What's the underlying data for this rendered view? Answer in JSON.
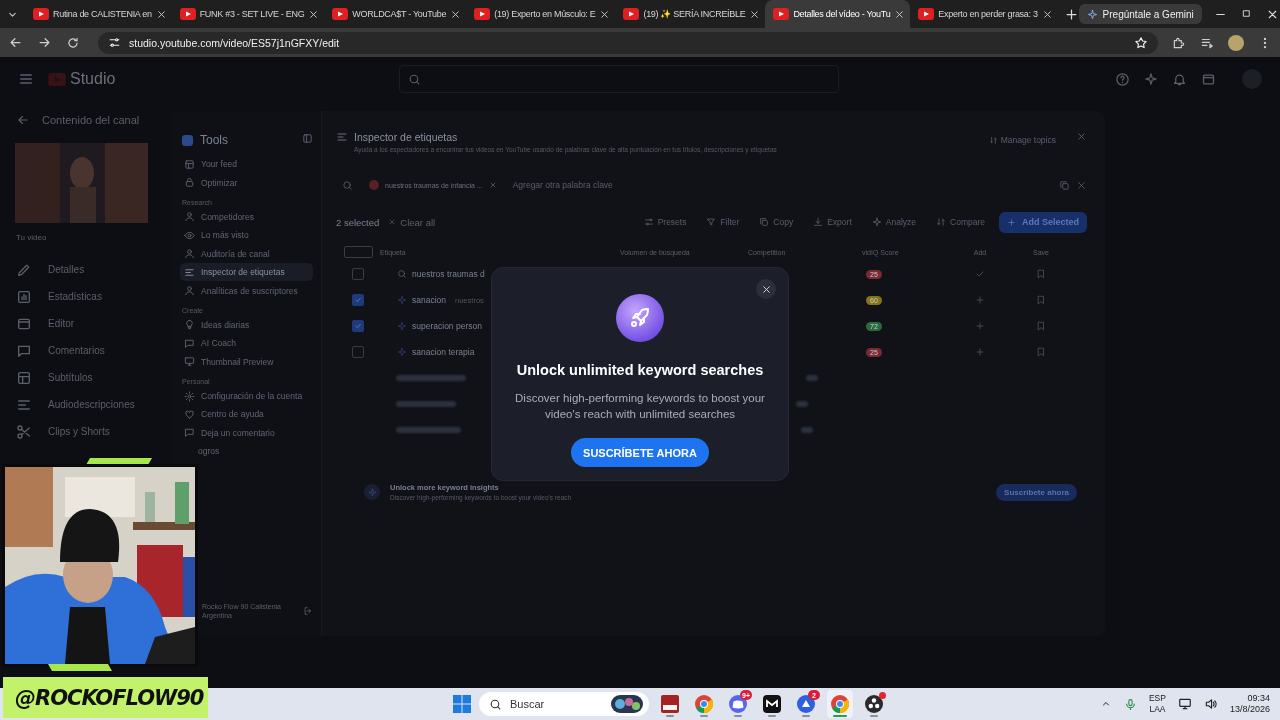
{
  "browser": {
    "tabs": [
      {
        "title": "Rutina de CALISTENIA en",
        "selected": false
      },
      {
        "title": "FUNK #3 - SET LIVE - ENG",
        "selected": false
      },
      {
        "title": "WORLDCA$T - YouTube",
        "selected": false
      },
      {
        "title": "(19) Experto en Músculo: E",
        "selected": false
      },
      {
        "title": "(19) ✨ SERÍA INCREÍBLE",
        "selected": false
      },
      {
        "title": "Detalles del vídeo - YouTu",
        "selected": true
      },
      {
        "title": "Experto en perder grasa: 3",
        "selected": false
      }
    ],
    "gemini_button": "Pregúntale a Gemini",
    "url": "studio.youtube.com/video/ES57j1nGFXY/edit"
  },
  "studio": {
    "logo": "Studio",
    "back_title": "Contenido del canal",
    "video_label": "Tu video",
    "nav": [
      "Detalles",
      "Estadísticas",
      "Editor",
      "Comentarios",
      "Subtítulos",
      "Audiodescripciones",
      "Clips y Shorts"
    ]
  },
  "tools": {
    "title": "Tools",
    "sections": [
      {
        "items": [
          {
            "label": "Your feed",
            "selected": false
          },
          {
            "label": "Optimizar",
            "selected": false
          }
        ]
      },
      {
        "heading": "Research",
        "items": [
          {
            "label": "Competidores",
            "selected": false
          },
          {
            "label": "Lo más visto",
            "selected": false
          },
          {
            "label": "Auditoría de canal",
            "selected": false
          },
          {
            "label": "Inspector de etiquetas",
            "selected": true
          },
          {
            "label": "Analíticas de suscriptores",
            "selected": false
          }
        ]
      },
      {
        "heading": "Create",
        "items": [
          {
            "label": "Ideas diarias",
            "selected": false
          },
          {
            "label": "AI Coach",
            "selected": false
          },
          {
            "label": "Thumbnail Preview",
            "selected": false
          }
        ]
      },
      {
        "heading": "Personal",
        "items": [
          {
            "label": "Configuración de la cuenta",
            "selected": false
          },
          {
            "label": "Centro de ayuda",
            "selected": false
          },
          {
            "label": "Deja un comentario",
            "selected": false
          },
          {
            "label": "ogros",
            "selected": false
          }
        ]
      }
    ],
    "account": {
      "name": "Rocko Flow 90 Calistenia",
      "country": "Argentina"
    }
  },
  "inspector": {
    "title": "Inspector de etiquetas",
    "subtitle": "Ayuda a los espectadores a encontrar tus videos en YouTube usando de palabras clave de alta puntuación en tus títulos, descripciones y etiquetas",
    "manage_topics": "Manage topics",
    "keyword_chip": "nuestros traumas de infancia ...",
    "search_placeholder": "Agregar otra palabra clave",
    "selected_count": "2 selected",
    "clear_all": "Clear all",
    "actions": [
      "Presets",
      "Filter",
      "Copy",
      "Export",
      "Analyze",
      "Compare"
    ],
    "add_selected": "Add Selected",
    "all_selected": false,
    "columns": [
      "Etiqueta",
      "Volumen de búsqueda",
      "Competition",
      "vidIQ Score",
      "Add",
      "Save"
    ],
    "rows": [
      {
        "kind": "seed",
        "keyword": "nuestros traumas d",
        "checked": false,
        "score": {
          "value": "25",
          "color": "#7a2a30"
        },
        "added": true
      },
      {
        "kind": "suggestion",
        "keyword": "sanacion",
        "note": "nuestros",
        "checked": true,
        "score": {
          "value": "60",
          "color": "#85741c"
        },
        "added": false
      },
      {
        "kind": "suggestion",
        "keyword": "superacion person",
        "checked": true,
        "score": {
          "value": "72",
          "color": "#2a6a3c"
        },
        "added": false
      },
      {
        "kind": "suggestion",
        "keyword": "sanacion terapia",
        "checked": false,
        "score": {
          "value": "25",
          "color": "#7a2a30"
        },
        "added": false
      }
    ],
    "upsell": {
      "title": "Unlock more keyword insights",
      "text": "Discover high-performing keywords to boost your video's reach",
      "button": "Suscríbete ahora"
    }
  },
  "modal": {
    "title": "Unlock unlimited keyword searches",
    "text": "Discover high-performing keywords to boost your video's reach with unlimited searches",
    "button": "SUSCRÍBETE AHORA"
  },
  "overlay": {
    "handle": "@ROCKOFLOW90"
  },
  "taskbar": {
    "search_placeholder": "Buscar",
    "apps": [
      {
        "kind": "tile",
        "active": false,
        "alert": false
      },
      {
        "kind": "browser",
        "active": false,
        "alert": false
      },
      {
        "kind": "chat",
        "badge": "9+",
        "active": false,
        "alert": false
      },
      {
        "kind": "editor",
        "active": false,
        "alert": false
      },
      {
        "kind": "games",
        "badge": "2",
        "active": false,
        "alert": false
      },
      {
        "kind": "browser",
        "active": true,
        "alert": false
      },
      {
        "kind": "recorder",
        "active": false,
        "alert": true
      }
    ],
    "language": "ESP",
    "layout": "LAA",
    "time": "09:34",
    "date": "13/8/2026"
  }
}
